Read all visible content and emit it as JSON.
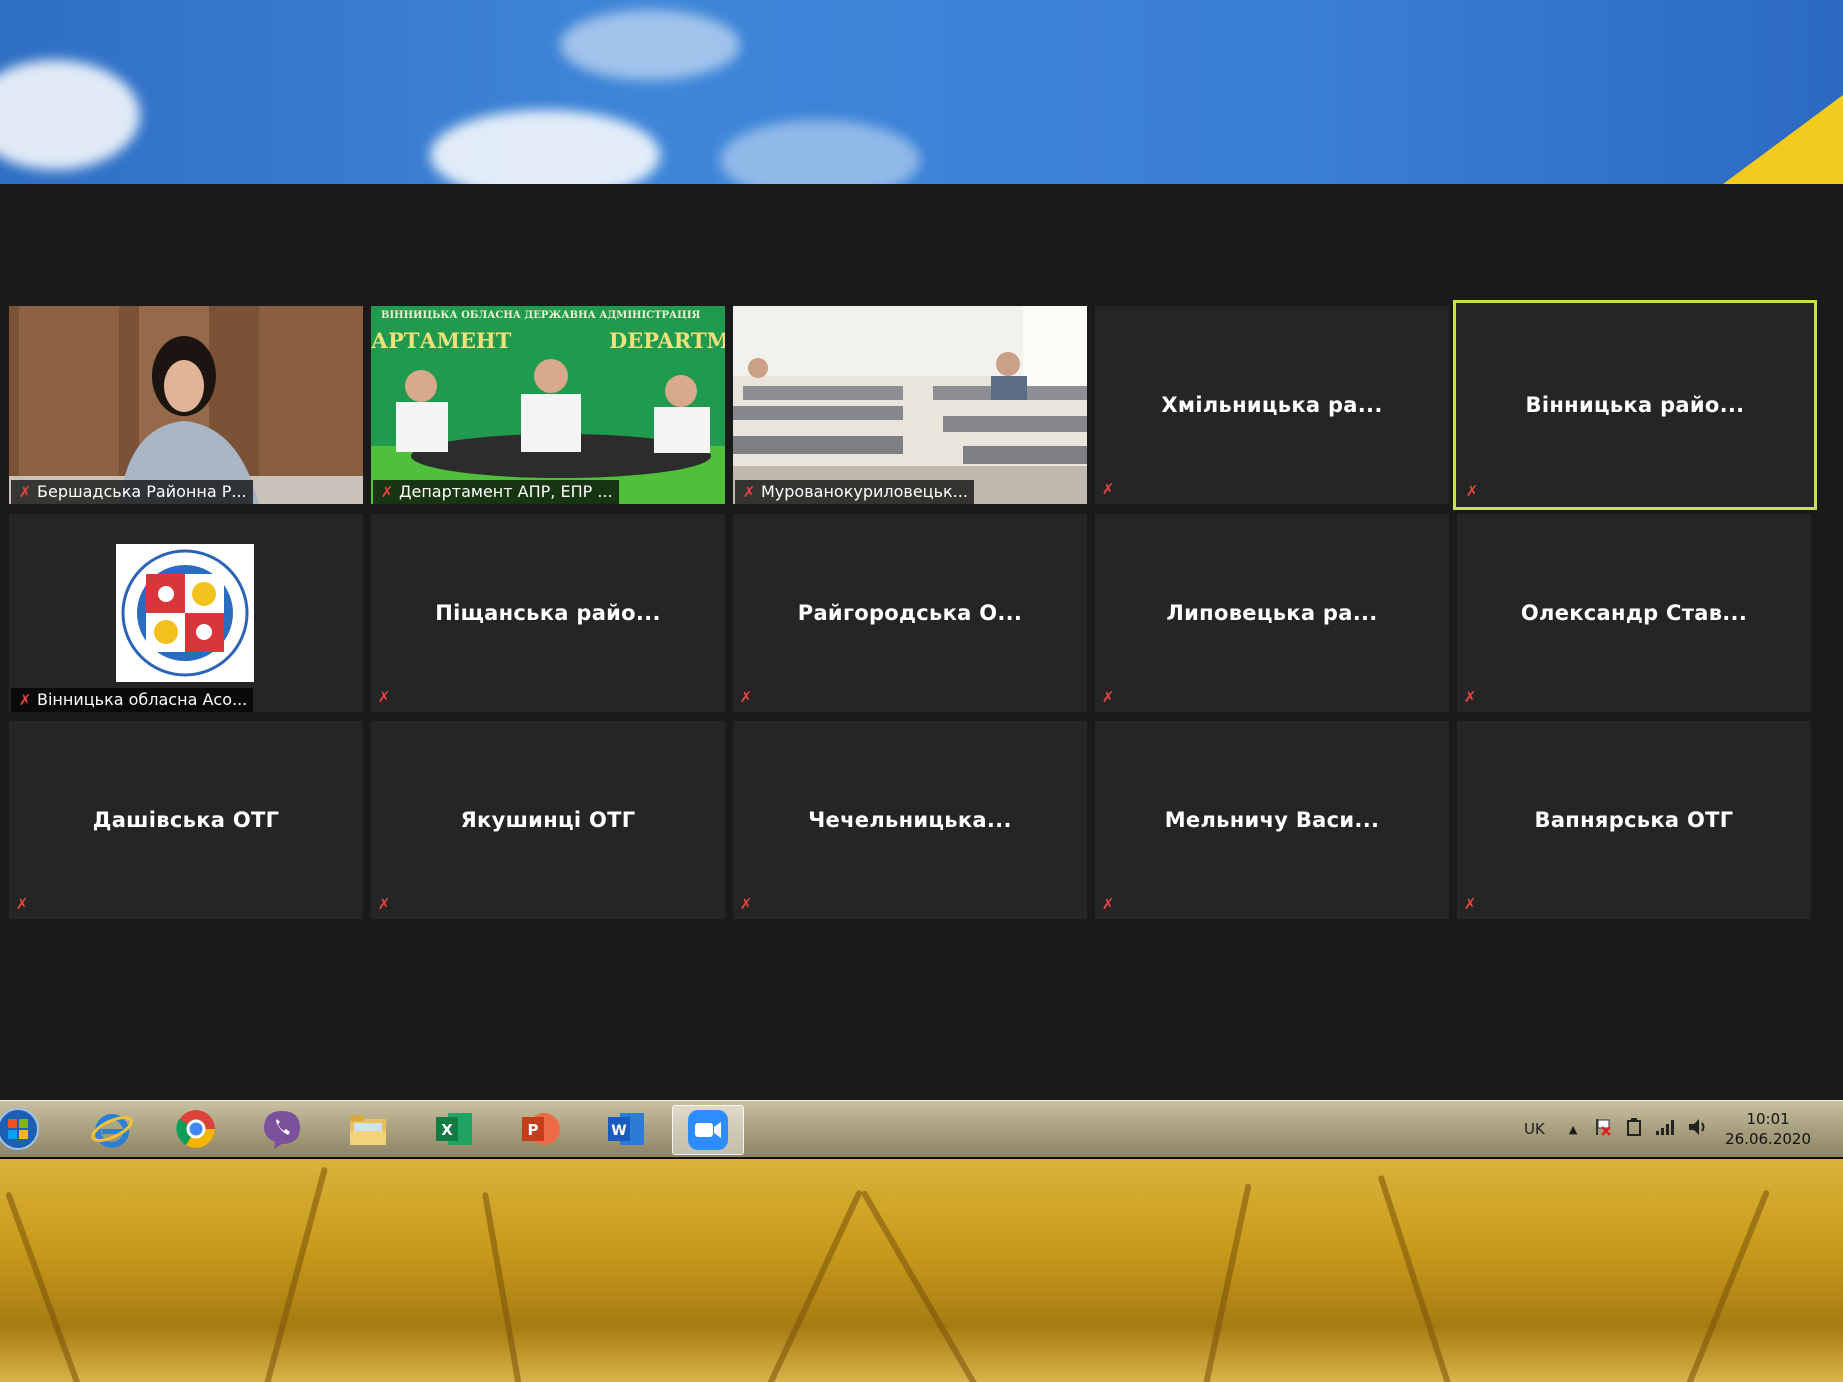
{
  "tiles": [
    {
      "name": "Бершадська Районна Р..."
    },
    {
      "name": "Департамент АПР, ЕПР ..."
    },
    {
      "name": "Мурованокуриловецьк..."
    },
    {
      "name": "Хмільницька  ра..."
    },
    {
      "name": "Вінницька  райо..."
    },
    {
      "name": "Вінницька обласна Асо..."
    },
    {
      "name": "Піщанська  райо..."
    },
    {
      "name": "Райгородська  О..."
    },
    {
      "name": "Липовецька  ра..."
    },
    {
      "name": "Олександр  Став..."
    },
    {
      "name": "Дашівська ОТГ"
    },
    {
      "name": "Якушинці ОТГ"
    },
    {
      "name": "Чечельницька..."
    },
    {
      "name": "Мельничу  Васи..."
    },
    {
      "name": "Вапнярська ОТГ"
    }
  ],
  "video_banner": {
    "line1": "ВІННИЦЬКА ОБЛАСНА ДЕРЖАВНА АДМІНІСТРАЦІЯ",
    "line2_left": "АРТАМЕНТ",
    "line2_right": "DEPARTM"
  },
  "taskbar": {
    "language": "UK",
    "time": "10:01",
    "date": "26.06.2020",
    "apps": [
      "start-icon",
      "internet-explorer-icon",
      "chrome-icon",
      "viber-icon",
      "file-explorer-icon",
      "excel-icon",
      "powerpoint-icon",
      "word-icon",
      "zoom-icon"
    ]
  },
  "colors": {
    "active_speaker": "#c8e34a",
    "muted": "#e54542",
    "tile_bg": "#252525"
  }
}
